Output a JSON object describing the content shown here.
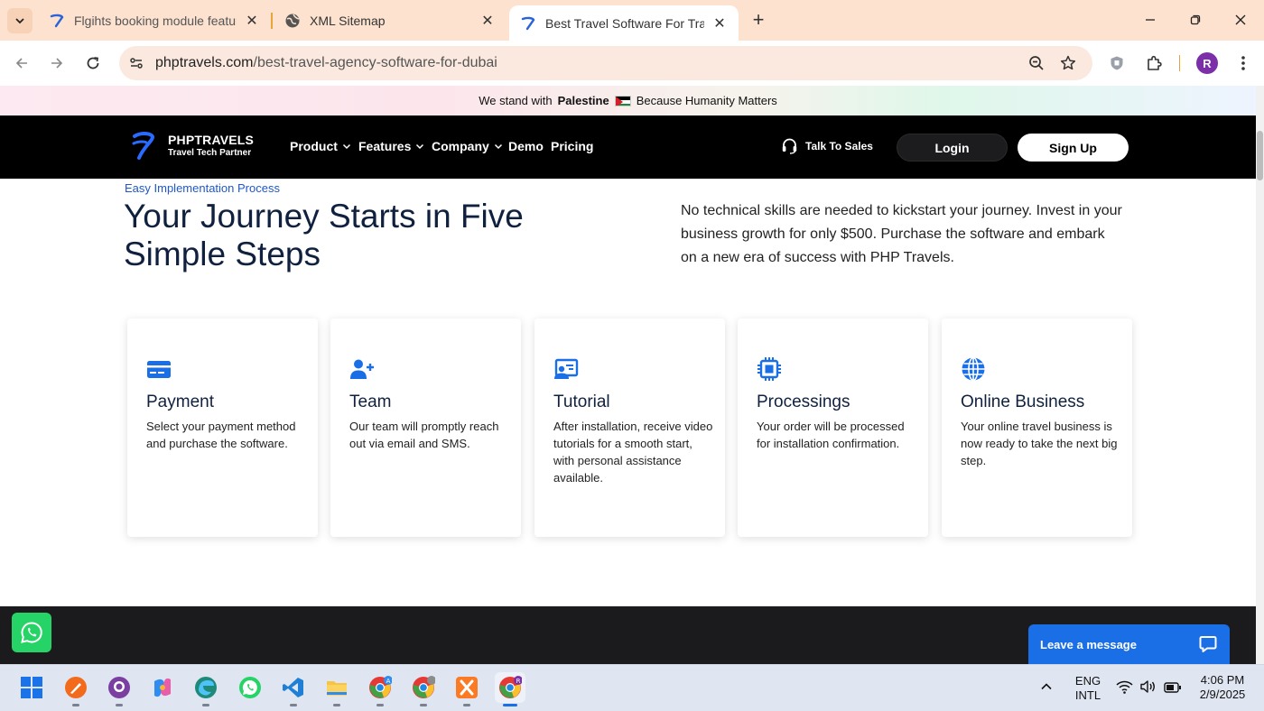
{
  "browser": {
    "tabs": [
      {
        "title": "Flgihts booking module feature",
        "active": false
      },
      {
        "title": "XML Sitemap",
        "active": false
      },
      {
        "title": "Best Travel Software For Travel A",
        "active": true
      }
    ],
    "url_host": "phptravels.com",
    "url_path": "/best-travel-agency-software-for-dubai",
    "profile_initial": "R"
  },
  "banner": {
    "prefix": "We stand with",
    "country": "Palestine",
    "suffix": "Because Humanity Matters"
  },
  "site_nav": {
    "logo_name": "PHPTRAVELS",
    "logo_tagline": "Travel Tech Partner",
    "menu": [
      {
        "label": "Product",
        "dropdown": true
      },
      {
        "label": "Features",
        "dropdown": true
      },
      {
        "label": "Company",
        "dropdown": true
      },
      {
        "label": "Demo",
        "dropdown": false
      },
      {
        "label": "Pricing",
        "dropdown": false
      }
    ],
    "talk_to_sales": "Talk To Sales",
    "login": "Login",
    "signup": "Sign Up"
  },
  "hero": {
    "eyebrow": "Easy Implementation Process",
    "title": "Your Journey Starts in Five Simple Steps",
    "description": "No technical skills are needed to kickstart your journey. Invest in your business growth for only $500. Purchase the software and embark on a new era of success with PHP Travels."
  },
  "steps": [
    {
      "icon": "credit-card-icon",
      "title": "Payment",
      "text": "Select your payment method and purchase the software."
    },
    {
      "icon": "user-plus-icon",
      "title": "Team",
      "text": "Our team will promptly reach out via email and SMS."
    },
    {
      "icon": "screen-tutorial-icon",
      "title": "Tutorial",
      "text": "After installation, receive video tutorials for a smooth start, with personal assistance available."
    },
    {
      "icon": "cpu-chip-icon",
      "title": "Processings",
      "text": "Your order will be processed for installation confirmation."
    },
    {
      "icon": "globe-icon",
      "title": "Online Business",
      "text": "Your online travel business is now ready to take the next big step."
    }
  ],
  "widgets": {
    "chat_label": "Leave a message"
  },
  "taskbar": {
    "language_line1": "ENG",
    "language_line2": "INTL",
    "time": "4:06 PM",
    "date": "2/9/2025"
  },
  "colors": {
    "accent_blue": "#1a6ee6",
    "nav_black": "#000000",
    "heading_navy": "#10213f",
    "tab_strip": "#fce2cf"
  }
}
